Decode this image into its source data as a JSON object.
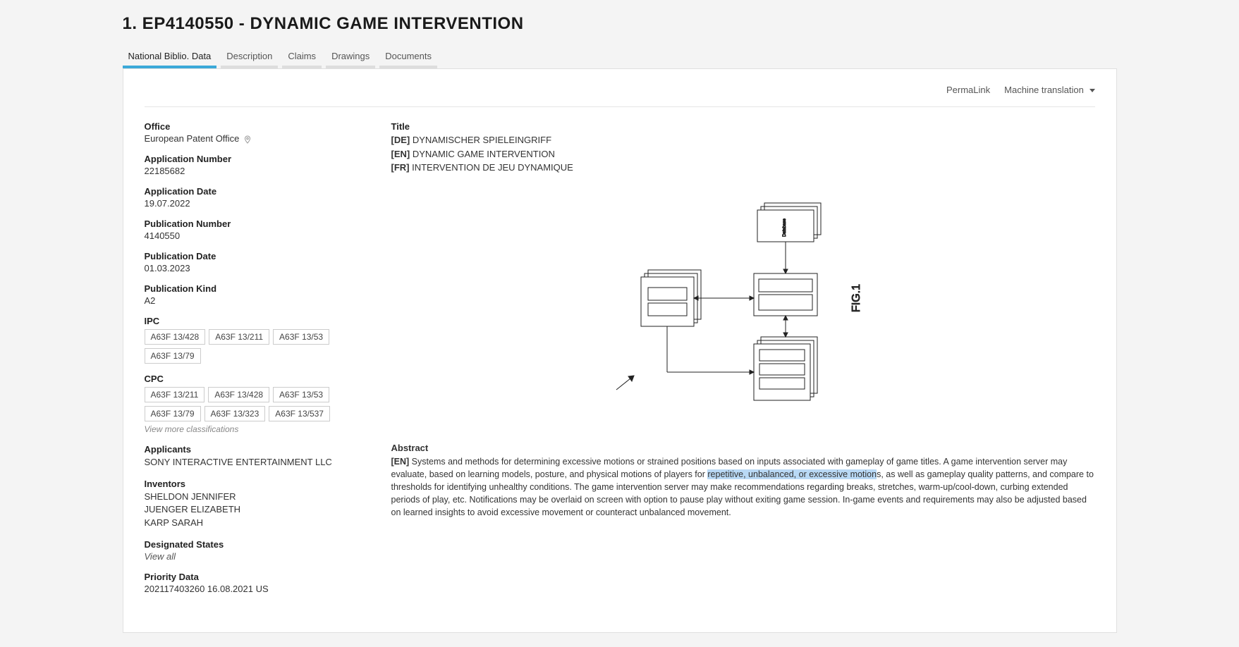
{
  "header": {
    "title": "1. EP4140550 - DYNAMIC GAME INTERVENTION"
  },
  "tabs": [
    {
      "label": "National Biblio. Data",
      "active": true
    },
    {
      "label": "Description"
    },
    {
      "label": "Claims"
    },
    {
      "label": "Drawings"
    },
    {
      "label": "Documents"
    }
  ],
  "actions": {
    "permalink": "PermaLink",
    "machine_translation": "Machine translation"
  },
  "biblio": {
    "office_label": "Office",
    "office_value": "European Patent Office",
    "app_num_label": "Application Number",
    "app_num_value": "22185682",
    "app_date_label": "Application Date",
    "app_date_value": "19.07.2022",
    "pub_num_label": "Publication Number",
    "pub_num_value": "4140550",
    "pub_date_label": "Publication Date",
    "pub_date_value": "01.03.2023",
    "pub_kind_label": "Publication Kind",
    "pub_kind_value": "A2",
    "ipc_label": "IPC",
    "ipc": [
      "A63F 13/428",
      "A63F 13/211",
      "A63F 13/53",
      "A63F 13/79"
    ],
    "cpc_label": "CPC",
    "cpc": [
      "A63F 13/211",
      "A63F 13/428",
      "A63F 13/53",
      "A63F 13/79",
      "A63F 13/323",
      "A63F 13/537"
    ],
    "view_more_class": "View more classifications",
    "applicants_label": "Applicants",
    "applicants": [
      "SONY INTERACTIVE ENTERTAINMENT LLC"
    ],
    "inventors_label": "Inventors",
    "inventors": [
      "SHELDON JENNIFER",
      "JUENGER ELIZABETH",
      "KARP SARAH"
    ],
    "designated_label": "Designated States",
    "view_all": "View all",
    "priority_label": "Priority Data",
    "priority_value": "202117403260 16.08.2021 US"
  },
  "titles": {
    "label": "Title",
    "entries": [
      {
        "lang": "[DE]",
        "text": "DYNAMISCHER SPIELEINGRIFF"
      },
      {
        "lang": "[EN]",
        "text": "DYNAMIC GAME INTERVENTION"
      },
      {
        "lang": "[FR]",
        "text": "INTERVENTION DE JEU DYNAMIQUE"
      }
    ]
  },
  "figure": {
    "caption": "FIG.1"
  },
  "abstract": {
    "label": "Abstract",
    "lang": "[EN]",
    "pre": " Systems and methods for determining excessive motions or strained positions based on inputs associated with gameplay of game titles. A game intervention server may evaluate, based on learning models, posture, and physical motions of players for ",
    "highlight": "repetitive, unbalanced, or excessive motion",
    "post": "s, as well as gameplay quality patterns, and compare to thresholds for identifying unhealthy conditions. The game intervention server may make recommendations regarding breaks, stretches, warm-up/cool-down, curbing extended periods of play, etc. Notifications may be overlaid on screen with option to pause play without exiting game session. In-game events and requirements may also be adjusted based on learned insights to avoid excessive movement or counteract unbalanced movement."
  }
}
